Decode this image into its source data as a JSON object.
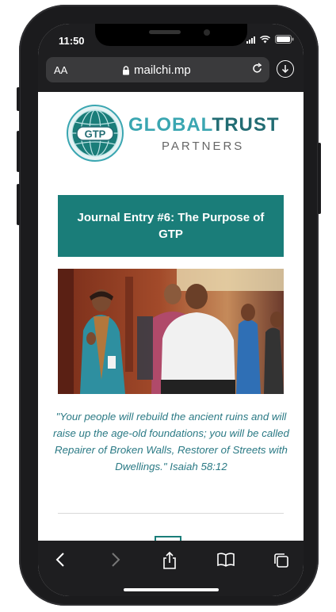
{
  "status_bar": {
    "time": "11:50"
  },
  "browser": {
    "text_size_label": "AA",
    "url": "mailchi.mp",
    "icons": [
      "lock-icon",
      "reload-icon",
      "download-icon"
    ]
  },
  "logo": {
    "badge_text": "GTP",
    "title_part1": "GLOBAL",
    "title_part2": "TRUST",
    "subtitle": "PARTNERS"
  },
  "article": {
    "title": "Journal Entry #6: The Purpose of GTP",
    "quote": "\"Your people will rebuild the ancient ruins and will raise up the age-old foundations; you will be called Repairer of Broken Walls, Restorer of Streets with Dwellings.\" Isaiah 58:12"
  },
  "toolbar": {
    "items": [
      "back-icon",
      "forward-icon",
      "share-icon",
      "bookmarks-icon",
      "tabs-icon"
    ]
  },
  "colors": {
    "accent": "#1a7d79",
    "quote_text": "#2b7a85",
    "logo_light": "#3aa6b1",
    "logo_dark": "#226c73",
    "browser_chrome": "#1e1e20"
  }
}
